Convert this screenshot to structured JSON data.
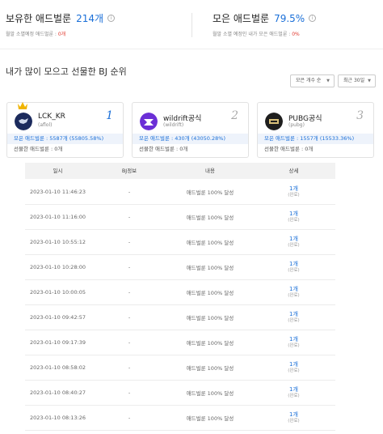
{
  "summary": {
    "owned_label": "보유한 애드벌룬",
    "owned_count": "214개",
    "owned_sub_prefix": "월말 소멸예정 애드벌룬 : ",
    "owned_sub_value": "0개",
    "collected_label": "모은 애드벌룬",
    "collected_pct": "79.5%",
    "collected_sub_prefix": "월말 소멸 예정인 내가 모은 애드벌룬 : ",
    "collected_sub_value": "0%",
    "info_glyph": "i"
  },
  "section_title": "내가 많이 모으고 선물한 BJ 순위",
  "filters": {
    "sort_selected": "모은 개수 순",
    "period_selected": "최근 30일"
  },
  "ranking": [
    {
      "name": "LCK_KR",
      "id": "(aflol)",
      "rank": "1",
      "collected": "모은 애드벌룬 : 5587개 (55805.58%)",
      "gifted": "선물한 애드벌룬 : 0개"
    },
    {
      "name": "wildrift공식",
      "id": "(wildrift)",
      "rank": "2",
      "collected": "모은 애드벌룬 : 430개 (43050.28%)",
      "gifted": "선물한 애드벌룬 : 0개"
    },
    {
      "name": "PUBG공식",
      "id": "(pubg)",
      "rank": "3",
      "collected": "모은 애드벌룬 : 1557개 (15533.36%)",
      "gifted": "선물한 애드벌룬 : 0개"
    }
  ],
  "table": {
    "headers": [
      "일시",
      "BJ정보",
      "내용",
      "상세"
    ],
    "rows": [
      {
        "date": "2023-01-10 11:46:23",
        "bj": "-",
        "content": "애드벌룬 100% 달성",
        "count": "1개",
        "status": "(완료)"
      },
      {
        "date": "2023-01-10 11:16:00",
        "bj": "-",
        "content": "애드벌룬 100% 달성",
        "count": "1개",
        "status": "(완료)"
      },
      {
        "date": "2023-01-10 10:55:12",
        "bj": "-",
        "content": "애드벌룬 100% 달성",
        "count": "1개",
        "status": "(완료)"
      },
      {
        "date": "2023-01-10 10:28:00",
        "bj": "-",
        "content": "애드벌룬 100% 달성",
        "count": "1개",
        "status": "(완료)"
      },
      {
        "date": "2023-01-10 10:00:05",
        "bj": "-",
        "content": "애드벌룬 100% 달성",
        "count": "1개",
        "status": "(완료)"
      },
      {
        "date": "2023-01-10 09:42:57",
        "bj": "-",
        "content": "애드벌룬 100% 달성",
        "count": "1개",
        "status": "(완료)"
      },
      {
        "date": "2023-01-10 09:17:39",
        "bj": "-",
        "content": "애드벌룬 100% 달성",
        "count": "1개",
        "status": "(완료)"
      },
      {
        "date": "2023-01-10 08:58:02",
        "bj": "-",
        "content": "애드벌룬 100% 달성",
        "count": "1개",
        "status": "(완료)"
      },
      {
        "date": "2023-01-10 08:40:27",
        "bj": "-",
        "content": "애드벌룬 100% 달성",
        "count": "1개",
        "status": "(완료)"
      },
      {
        "date": "2023-01-10 08:13:26",
        "bj": "-",
        "content": "애드벌룬 100% 달성",
        "count": "1개",
        "status": "(완료)"
      }
    ]
  },
  "icons": {
    "info": "info-icon",
    "crown": "crown-icon",
    "caret": "chevron-down-icon"
  },
  "colors": {
    "accent": "#1a6fd8",
    "warning": "#e0352b"
  }
}
